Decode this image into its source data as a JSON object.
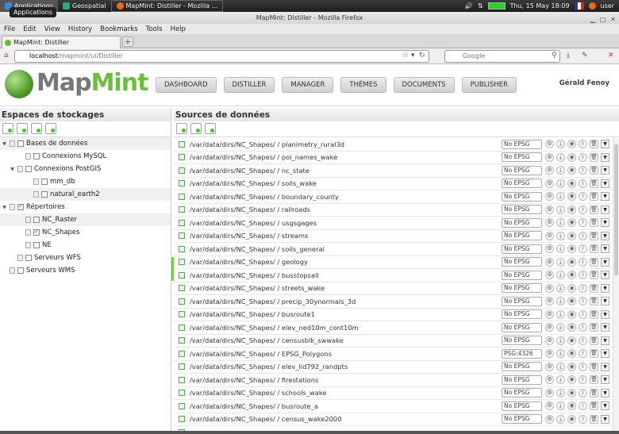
{
  "taskbar": {
    "applications": "Applications",
    "geospatial": "Geospatial",
    "window": "MapMint: Distiller - Mozilla ...",
    "datetime": "Thu, 15 May  18:09",
    "user": "user",
    "tooltip": "Applications"
  },
  "window": {
    "title": "MapMint: Distiller - Mozilla Firefox"
  },
  "menu": [
    "File",
    "Edit",
    "View",
    "History",
    "Bookmarks",
    "Tools",
    "Help"
  ],
  "tab": {
    "label": "MapMint: Distiller"
  },
  "url": {
    "host": "localhost",
    "path": "/mapmint/ui/Distiller"
  },
  "search": {
    "placeholder": "Google"
  },
  "logo": {
    "part1": "Map",
    "part2": "Mint"
  },
  "nav": [
    "DASHBOARD",
    "DISTILLER",
    "MANAGER",
    "THÈMES",
    "DOCUMENTS",
    "PUBLISHER"
  ],
  "user": "Gérald Fenoy",
  "left": {
    "title": "Espaces de stockages",
    "tree": [
      {
        "label": "Bases de données",
        "indent": 0,
        "tri": "▼",
        "bg": true
      },
      {
        "label": "Connexions MySQL",
        "indent": 2,
        "tri": "",
        "bg": false
      },
      {
        "label": "Connexions PostGIS",
        "indent": 1,
        "tri": "▼",
        "bg": false
      },
      {
        "label": "mm_db",
        "indent": 3,
        "tri": "",
        "bg": false
      },
      {
        "label": "natural_earth2",
        "indent": 3,
        "tri": "",
        "bg": true
      },
      {
        "label": "Répertoires",
        "indent": 0,
        "tri": "▼",
        "bg": false,
        "checked": true
      },
      {
        "label": "NC_Raster",
        "indent": 2,
        "tri": "",
        "bg": true
      },
      {
        "label": "NC_Shapes",
        "indent": 2,
        "tri": "",
        "bg": false,
        "checked": true
      },
      {
        "label": "NE",
        "indent": 2,
        "tri": "",
        "bg": false
      },
      {
        "label": "Serveurs WFS",
        "indent": 1,
        "tri": "",
        "bg": false
      },
      {
        "label": "Serveurs WMS",
        "indent": 0,
        "tri": "",
        "bg": false
      }
    ]
  },
  "right": {
    "title": "Sources de données",
    "rows": [
      {
        "path": "/var/data/dirs/NC_Shapes/ / planimetry_rural3d",
        "epsg": "No EPSG"
      },
      {
        "path": "/var/data/dirs/NC_Shapes/ / poi_names_wake",
        "epsg": "No EPSG"
      },
      {
        "path": "/var/data/dirs/NC_Shapes/ / nc_state",
        "epsg": "No EPSG"
      },
      {
        "path": "/var/data/dirs/NC_Shapes/ / soils_wake",
        "epsg": "No EPSG"
      },
      {
        "path": "/var/data/dirs/NC_Shapes/ / boundary_county",
        "epsg": "No EPSG"
      },
      {
        "path": "/var/data/dirs/NC_Shapes/ / railroads",
        "epsg": "No EPSG"
      },
      {
        "path": "/var/data/dirs/NC_Shapes/ / usgsgages",
        "epsg": "No EPSG"
      },
      {
        "path": "/var/data/dirs/NC_Shapes/ / streams",
        "epsg": "No EPSG"
      },
      {
        "path": "/var/data/dirs/NC_Shapes/ / soils_general",
        "epsg": "No EPSG"
      },
      {
        "path": "/var/data/dirs/NC_Shapes/ / geology",
        "epsg": "No EPSG"
      },
      {
        "path": "/var/data/dirs/NC_Shapes/ / busstopsall",
        "epsg": "No EPSG"
      },
      {
        "path": "/var/data/dirs/NC_Shapes/ / streets_wake",
        "epsg": "No EPSG"
      },
      {
        "path": "/var/data/dirs/NC_Shapes/ / precip_30ynormals_3d",
        "epsg": "No EPSG"
      },
      {
        "path": "/var/data/dirs/NC_Shapes/ / busroute1",
        "epsg": "No EPSG"
      },
      {
        "path": "/var/data/dirs/NC_Shapes/ / elev_ned10m_cont10m",
        "epsg": "No EPSG"
      },
      {
        "path": "/var/data/dirs/NC_Shapes/ / censusblk_swwake",
        "epsg": "No EPSG"
      },
      {
        "path": "/var/data/dirs/NC_Shapes/ / EPSG_Polygons",
        "epsg": "PSG:4326"
      },
      {
        "path": "/var/data/dirs/NC_Shapes/ / elev_lid792_randpts",
        "epsg": "No EPSG"
      },
      {
        "path": "/var/data/dirs/NC_Shapes/ / firestations",
        "epsg": "No EPSG"
      },
      {
        "path": "/var/data/dirs/NC_Shapes/ / schools_wake",
        "epsg": "No EPSG"
      },
      {
        "path": "/var/data/dirs/NC_Shapes/ / busroute_a",
        "epsg": "No EPSG"
      },
      {
        "path": "/var/data/dirs/NC_Shapes/ / census_wake2000",
        "epsg": "No EPSG"
      },
      {
        "path": "",
        "epsg": ""
      }
    ]
  },
  "icons": [
    "settings-icon",
    "download-icon",
    "eye-icon",
    "info-icon",
    "delete-icon",
    "dropdown-icon"
  ]
}
